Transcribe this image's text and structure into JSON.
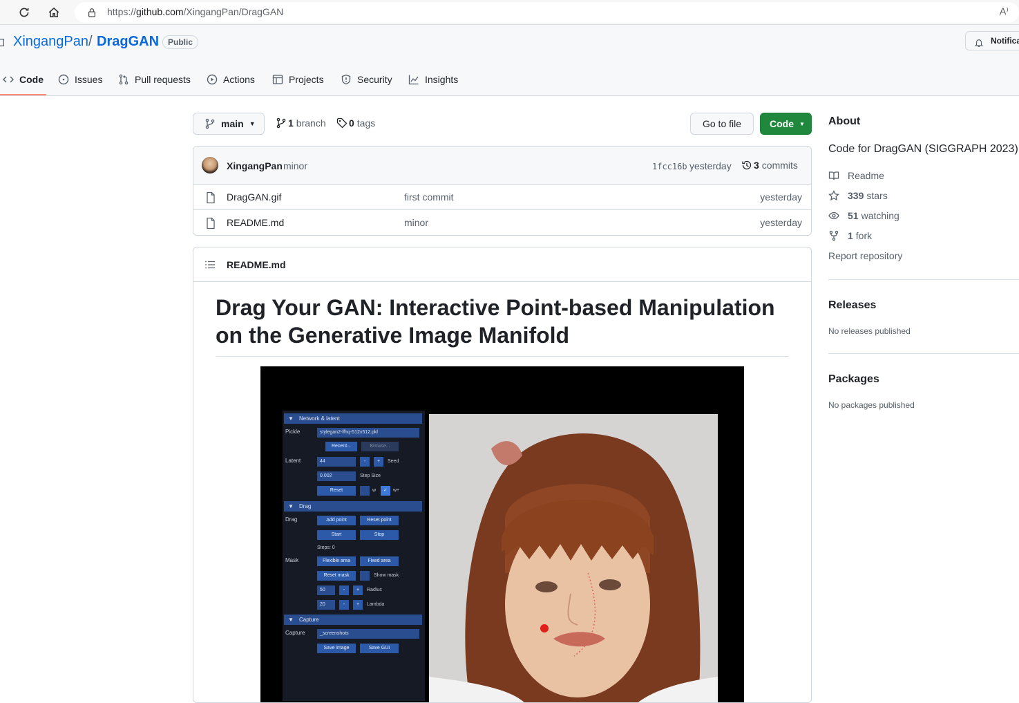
{
  "browser": {
    "url_prefix": "https://",
    "url_host": "github.com",
    "url_path": "/XingangPan/DragGAN",
    "read_aloud": "A⁾"
  },
  "repo": {
    "owner": "XingangPan",
    "separator": "/",
    "name": "DragGAN",
    "visibility": "Public",
    "notifications_label": "Notifications"
  },
  "tabs": [
    {
      "label": "Code",
      "active": true
    },
    {
      "label": "Issues"
    },
    {
      "label": "Pull requests"
    },
    {
      "label": "Actions"
    },
    {
      "label": "Projects"
    },
    {
      "label": "Security"
    },
    {
      "label": "Insights"
    }
  ],
  "toolbar": {
    "branch": "main",
    "branch_count": "1",
    "branch_label": "branch",
    "tag_count": "0",
    "tag_label": "tags",
    "go_to_file": "Go to file",
    "code_label": "Code"
  },
  "latest_commit": {
    "author": "XingangPan",
    "message": "minor",
    "sha": "1fcc16b",
    "time": "yesterday",
    "commit_count": "3",
    "commit_label": "commits"
  },
  "files": [
    {
      "name": "DragGAN.gif",
      "message": "first commit",
      "time": "yesterday"
    },
    {
      "name": "README.md",
      "message": "minor",
      "time": "yesterday"
    }
  ],
  "readme": {
    "filename": "README.md",
    "title": "Drag Your GAN: Interactive Point-based Manipulation on the Generative Image Manifold",
    "demo": {
      "sections": {
        "network": "Network & latent",
        "drag": "Drag",
        "capture": "Capture"
      },
      "labels": {
        "pickle": "Pickle",
        "latent": "Latent",
        "drag": "Drag",
        "mask": "Mask",
        "capture": "Capture"
      },
      "pickle_value": "stylegan2-ffhq-512x512.pkl",
      "recent": "Recent...",
      "browse": "Browse...",
      "seed_value": "44",
      "minus": "-",
      "plus": "+",
      "seed": "Seed",
      "step_value": "0.002",
      "step_size": "Step Size",
      "reset": "Reset",
      "w": "w",
      "wplus": "w+",
      "add_point": "Add point",
      "reset_point": "Reset point",
      "start": "Start",
      "stop": "Stop",
      "steps": "Steps: 0",
      "flexible_area": "Flexible area",
      "fixed_area": "Fixed area",
      "reset_mask": "Reset mask",
      "show_mask": "Show mask",
      "radius_value": "50",
      "radius": "Radius",
      "lambda_value": "20",
      "lambda": "Lambda",
      "capture_value": "_screenshots",
      "save_image": "Save image",
      "save_gui": "Save GUI"
    }
  },
  "about": {
    "heading": "About",
    "description": "Code for DragGAN (SIGGRAPH 2023)",
    "readme": "Readme",
    "stars_count": "339",
    "stars_label": "stars",
    "watching_count": "51",
    "watching_label": "watching",
    "fork_count": "1",
    "fork_label": "fork",
    "report": "Report repository"
  },
  "releases": {
    "heading": "Releases",
    "empty": "No releases published"
  },
  "packages": {
    "heading": "Packages",
    "empty": "No packages published"
  }
}
